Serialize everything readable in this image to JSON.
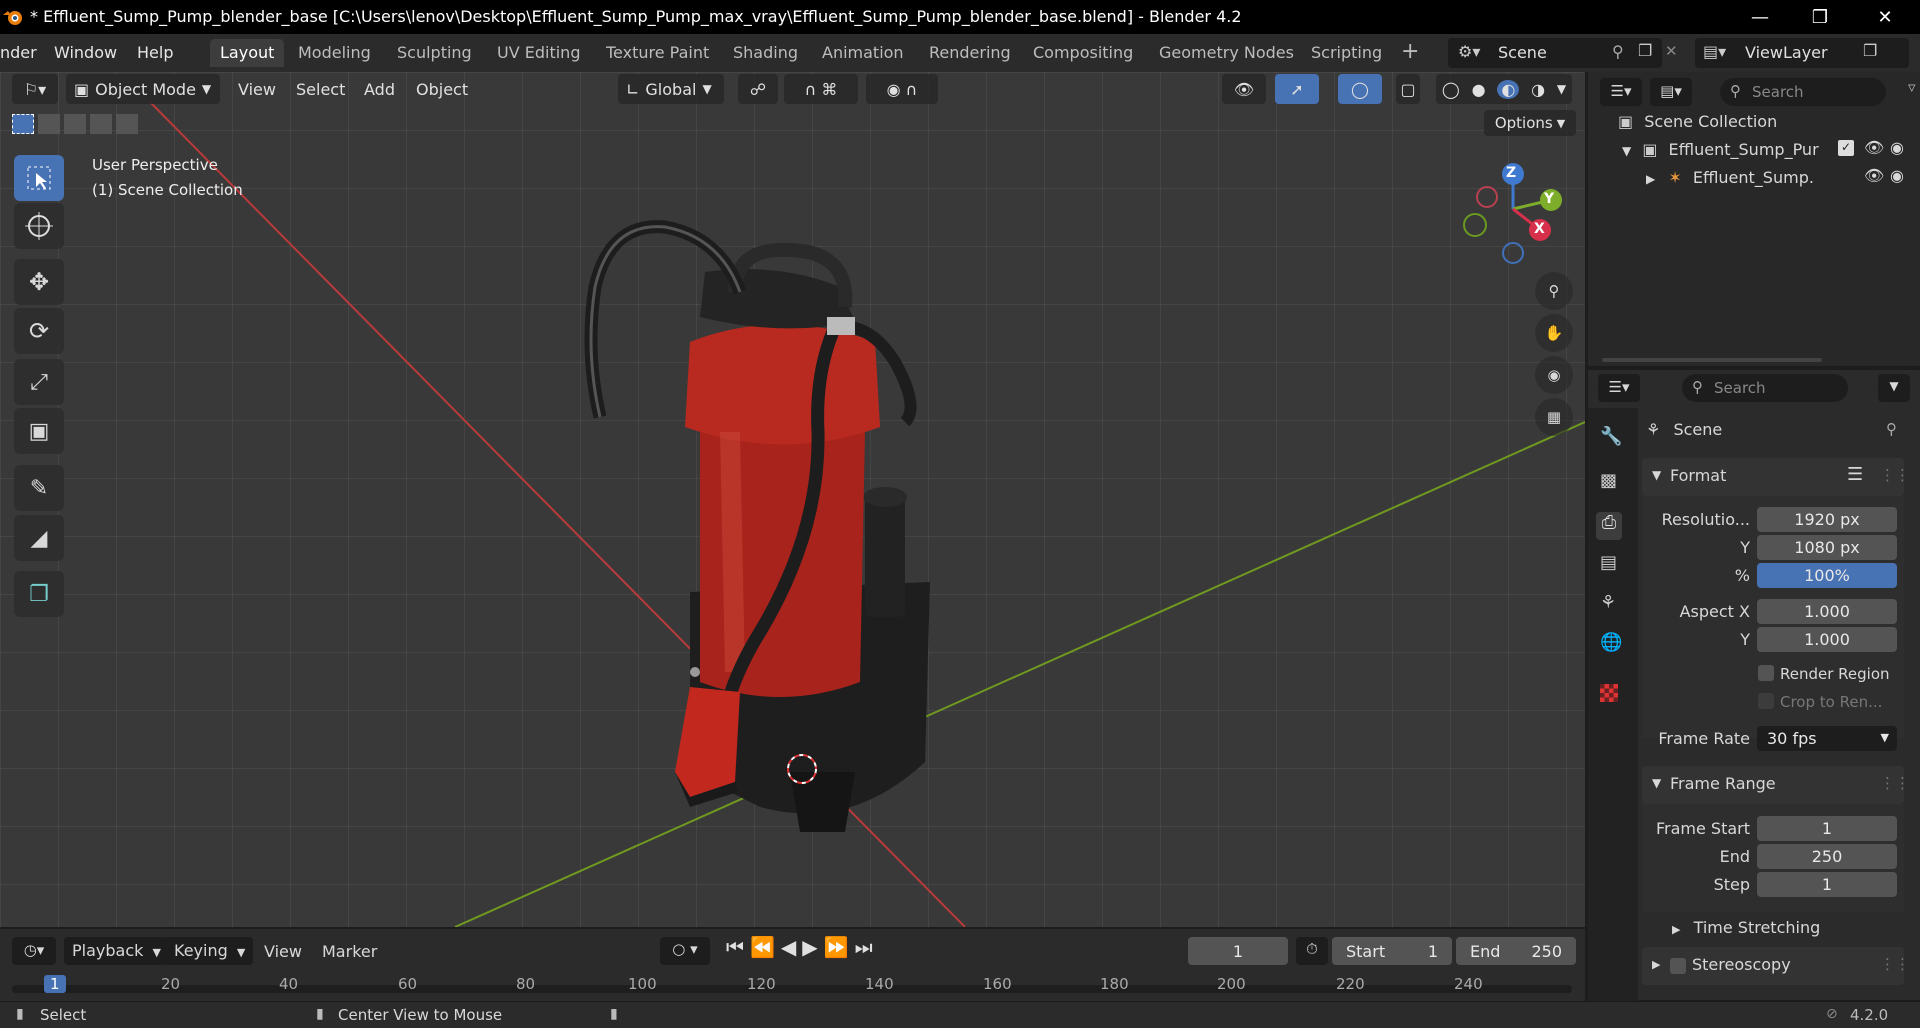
{
  "titlebar": {
    "title": "* Effluent_Sump_Pump_blender_base [C:\\Users\\lenov\\Desktop\\Effluent_Sump_Pump_max_vray\\Effluent_Sump_Pump_blender_base.blend] - Blender 4.2"
  },
  "menus": [
    "nder",
    "Window",
    "Help"
  ],
  "workspaces": [
    "Layout",
    "Modeling",
    "Sculpting",
    "UV Editing",
    "Texture Paint",
    "Shading",
    "Animation",
    "Rendering",
    "Compositing",
    "Geometry Nodes",
    "Scripting"
  ],
  "scene": {
    "name": "Scene",
    "view_layer": "ViewLayer"
  },
  "viewport_header": {
    "mode": "Object Mode",
    "menus": [
      "View",
      "Select",
      "Add",
      "Object"
    ],
    "transform": "Global",
    "options": "Options"
  },
  "viewport_overlay": {
    "perspective": "User Perspective",
    "collection": "(1) Scene Collection"
  },
  "gizmo": {
    "z": "Z",
    "y": "Y",
    "x": "X"
  },
  "outliner": {
    "search_placeholder": "Search",
    "root": "Scene Collection",
    "items": [
      "Effluent_Sump_Pur",
      "Effluent_Sump."
    ]
  },
  "properties": {
    "search_placeholder": "Search",
    "scene_label": "Scene",
    "format": {
      "title": "Format",
      "res_label": "Resolutio...",
      "res_x": "1920 px",
      "y_label": "Y",
      "res_y": "1080 px",
      "pct_label": "%",
      "pct": "100%",
      "aspect_x_label": "Aspect X",
      "aspect_x": "1.000",
      "aspect_y_label": "Y",
      "aspect_y": "1.000",
      "render_region": "Render Region",
      "crop": "Crop to Ren...",
      "frame_rate_label": "Frame Rate",
      "frame_rate": "30 fps"
    },
    "frame_range": {
      "title": "Frame Range",
      "start_label": "Frame Start",
      "start": "1",
      "end_label": "End",
      "end": "250",
      "step_label": "Step",
      "step": "1"
    },
    "time_stretching": "Time Stretching",
    "stereoscopy": "Stereoscopy"
  },
  "timeline": {
    "menus": [
      "Playback",
      "Keying",
      "View",
      "Marker"
    ],
    "current_frame": "1",
    "start_label": "Start",
    "start": "1",
    "end_label": "End",
    "end": "250",
    "ticks": [
      "1",
      "20",
      "40",
      "60",
      "80",
      "100",
      "120",
      "140",
      "160",
      "180",
      "200",
      "220",
      "240"
    ]
  },
  "statusbar": {
    "select": "Select",
    "center": "Center View to Mouse",
    "version": "4.2.0"
  },
  "colors": {
    "accent": "#4772b3",
    "pump_red": "#b3261e",
    "axis_x": "#c0392b",
    "axis_y": "#7da22b"
  }
}
